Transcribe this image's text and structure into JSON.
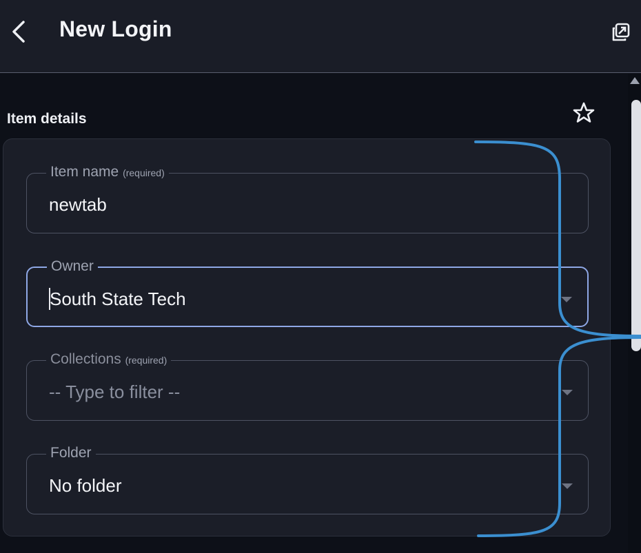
{
  "header": {
    "title": "New Login",
    "back_icon": "chevron-left-icon",
    "popout_icon": "popout-window-icon"
  },
  "section": {
    "title": "Item details",
    "favorite_icon": "star-outline-icon"
  },
  "fields": {
    "item_name": {
      "label": "Item name",
      "required": "(required)",
      "value": "newtab"
    },
    "owner": {
      "label": "Owner",
      "value": "South State Tech"
    },
    "collections": {
      "label": "Collections",
      "required": "(required)",
      "placeholder": "-- Type to filter --"
    },
    "folder": {
      "label": "Folder",
      "value": "No folder"
    }
  },
  "colors": {
    "background": "#0d1018",
    "header": "#1a1d27",
    "card": "#1b1e28",
    "focus_border": "#8fa8e6",
    "annotation_bracket": "#3b8fd0"
  }
}
